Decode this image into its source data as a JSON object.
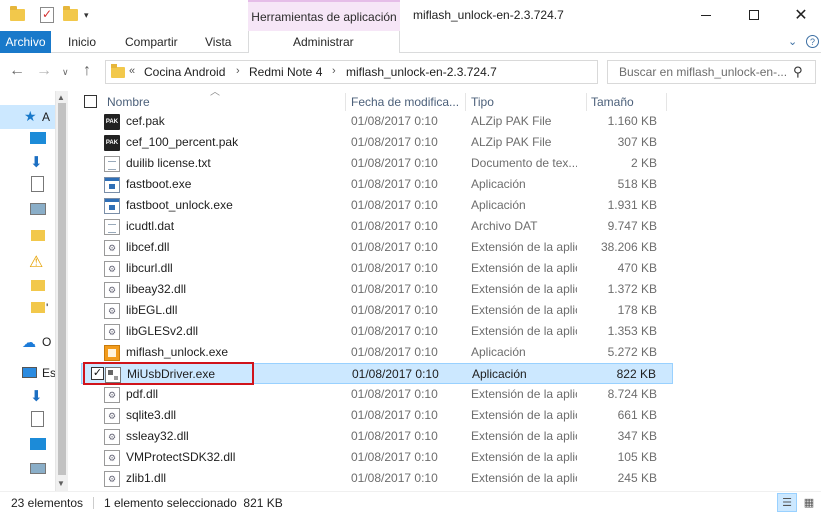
{
  "window": {
    "title": "miflash_unlock-en-2.3.724.7",
    "context_tab_group": "Herramientas de aplicación",
    "minimize": "—",
    "maximize": "☐",
    "close": "✕"
  },
  "ribbon": {
    "tabs": [
      "Archivo",
      "Inicio",
      "Compartir",
      "Vista",
      "Administrar"
    ],
    "active_tab": "Archivo",
    "collapse_icon": "⌄",
    "help_icon": "?"
  },
  "address": {
    "overflow": "«",
    "breadcrumbs": [
      "Cocina Android",
      "Redmi Note 4",
      "miflash_unlock-en-2.3.724.7"
    ],
    "separator": "›",
    "search_placeholder": "Buscar en miflash_unlock-en-..."
  },
  "nav_pane": {
    "items": [
      {
        "icon": "quick-access-star-icon",
        "label": "A"
      },
      {
        "icon": "desktop-icon",
        "label": ""
      },
      {
        "icon": "downloads-icon",
        "label": ""
      },
      {
        "icon": "documents-icon",
        "label": ""
      },
      {
        "icon": "pictures-icon",
        "label": ""
      },
      {
        "icon": "folder-icon",
        "label": ""
      },
      {
        "icon": "warning-icon",
        "label": ""
      },
      {
        "icon": "folder-icon",
        "label": ""
      },
      {
        "icon": "folder-icon",
        "label": "'"
      },
      {
        "icon": "onedrive-icon",
        "label": "O"
      },
      {
        "icon": "this-pc-icon",
        "label": "Es"
      },
      {
        "icon": "downloads-icon",
        "label": ""
      },
      {
        "icon": "documents-icon",
        "label": ""
      },
      {
        "icon": "desktop-icon",
        "label": ""
      },
      {
        "icon": "pictures-icon",
        "label": ""
      }
    ]
  },
  "columns": {
    "name": "Nombre",
    "date": "Fecha de modifica...",
    "type": "Tipo",
    "size": "Tamaño"
  },
  "files": [
    {
      "name": "cef.pak",
      "date": "01/08/2017 0:10",
      "type": "ALZip PAK File",
      "size": "1.160 KB",
      "icon": "pak"
    },
    {
      "name": "cef_100_percent.pak",
      "date": "01/08/2017 0:10",
      "type": "ALZip PAK File",
      "size": "307 KB",
      "icon": "pak"
    },
    {
      "name": "duilib license.txt",
      "date": "01/08/2017 0:10",
      "type": "Documento de tex...",
      "size": "2 KB",
      "icon": "doc"
    },
    {
      "name": "fastboot.exe",
      "date": "01/08/2017 0:10",
      "type": "Aplicación",
      "size": "518 KB",
      "icon": "exe"
    },
    {
      "name": "fastboot_unlock.exe",
      "date": "01/08/2017 0:10",
      "type": "Aplicación",
      "size": "1.931 KB",
      "icon": "exe"
    },
    {
      "name": "icudtl.dat",
      "date": "01/08/2017 0:10",
      "type": "Archivo DAT",
      "size": "9.747 KB",
      "icon": "doc"
    },
    {
      "name": "libcef.dll",
      "date": "01/08/2017 0:10",
      "type": "Extensión de la aplic...",
      "size": "38.206 KB",
      "icon": "dll"
    },
    {
      "name": "libcurl.dll",
      "date": "01/08/2017 0:10",
      "type": "Extensión de la aplic...",
      "size": "470 KB",
      "icon": "dll"
    },
    {
      "name": "libeay32.dll",
      "date": "01/08/2017 0:10",
      "type": "Extensión de la aplic...",
      "size": "1.372 KB",
      "icon": "dll"
    },
    {
      "name": "libEGL.dll",
      "date": "01/08/2017 0:10",
      "type": "Extensión de la aplic...",
      "size": "178 KB",
      "icon": "dll"
    },
    {
      "name": "libGLESv2.dll",
      "date": "01/08/2017 0:10",
      "type": "Extensión de la aplic...",
      "size": "1.353 KB",
      "icon": "dll"
    },
    {
      "name": "miflash_unlock.exe",
      "date": "01/08/2017 0:10",
      "type": "Aplicación",
      "size": "5.272 KB",
      "icon": "miflash"
    },
    {
      "name": "MiUsbDriver.exe",
      "date": "01/08/2017 0:10",
      "type": "Aplicación",
      "size": "822 KB",
      "icon": "msi",
      "selected": true
    },
    {
      "name": "pdf.dll",
      "date": "01/08/2017 0:10",
      "type": "Extensión de la aplic...",
      "size": "8.724 KB",
      "icon": "dll"
    },
    {
      "name": "sqlite3.dll",
      "date": "01/08/2017 0:10",
      "type": "Extensión de la aplic...",
      "size": "661 KB",
      "icon": "dll"
    },
    {
      "name": "ssleay32.dll",
      "date": "01/08/2017 0:10",
      "type": "Extensión de la aplic...",
      "size": "347 KB",
      "icon": "dll"
    },
    {
      "name": "VMProtectSDK32.dll",
      "date": "01/08/2017 0:10",
      "type": "Extensión de la aplic...",
      "size": "105 KB",
      "icon": "dll"
    },
    {
      "name": "zlib1.dll",
      "date": "01/08/2017 0:10",
      "type": "Extensión de la aplic...",
      "size": "245 KB",
      "icon": "dll"
    }
  ],
  "status": {
    "count": "23 elementos",
    "selection": "1 elemento seleccionado  821 KB"
  },
  "colors": {
    "accent": "#1979ca",
    "selection": "#cce8ff",
    "selection_border": "#99d1ff",
    "highlight_box": "#d0131b",
    "context_tab": "#f6e6f7"
  }
}
